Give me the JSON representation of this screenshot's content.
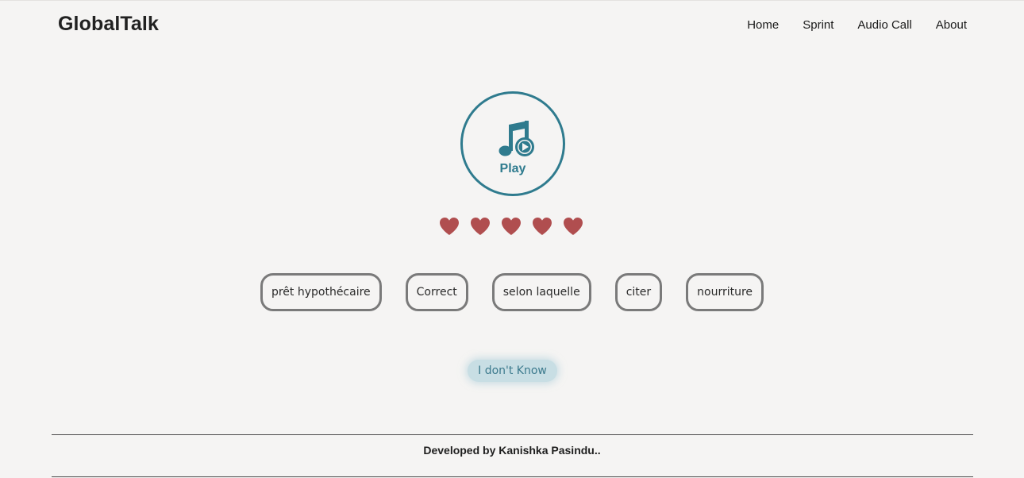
{
  "navbar": {
    "brand": "GlobalTalk",
    "links": [
      {
        "label": "Home"
      },
      {
        "label": "Sprint"
      },
      {
        "label": "Audio Call"
      },
      {
        "label": "About"
      }
    ]
  },
  "game": {
    "play_label": "Play",
    "play_icon": "music-note-play-icon",
    "lives": {
      "remaining": 5,
      "total": 5,
      "icon": "heart-icon",
      "color": "#b04e4f"
    },
    "options": [
      {
        "label": "prêt hypothécaire"
      },
      {
        "label": "Correct"
      },
      {
        "label": "selon laquelle"
      },
      {
        "label": "citer"
      },
      {
        "label": "nourriture"
      }
    ],
    "dont_know_label": "I don't Know"
  },
  "footer": {
    "credit": "Developed by Kanishka Pasindu.."
  },
  "colors": {
    "accent": "#2f7b8e",
    "heart": "#b04e4f",
    "background": "#f5f4f3",
    "option_border": "#7a7a7a",
    "dont_know_bg": "#c8dee4"
  }
}
